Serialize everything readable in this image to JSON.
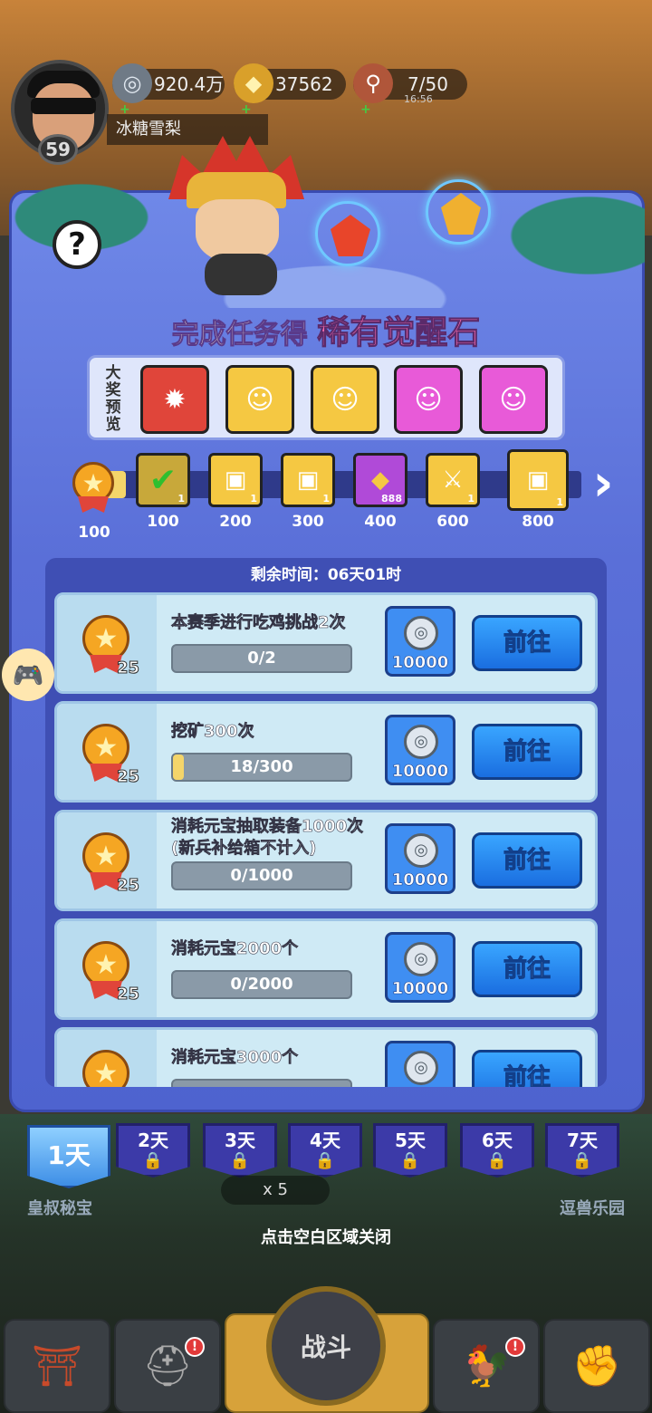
{
  "hud": {
    "player_name": "冰糖雪梨",
    "level": "59",
    "resources": [
      {
        "icon": "silver-coin-icon",
        "value": "920.4万"
      },
      {
        "icon": "gold-ingot-icon",
        "value": "37562"
      },
      {
        "icon": "meat-icon",
        "value": "7/50",
        "timer": "16:56"
      }
    ]
  },
  "event": {
    "title_prefix": "完成任务得",
    "title_highlight": "稀有觉醒石",
    "preview_label": "大奖预览",
    "preview_items": [
      {
        "icon": "red-puzzle-piece-icon",
        "color": "#e0453a"
      },
      {
        "icon": "hero-portrait-icon",
        "color": "#f5c842"
      },
      {
        "icon": "hero-portrait-icon",
        "color": "#f5c842"
      },
      {
        "icon": "heroine-portrait-icon",
        "color": "#e85ad8"
      },
      {
        "icon": "heroine-portrait-icon",
        "color": "#e85ad8"
      }
    ],
    "current_points": "100",
    "progress_fraction": 0.05,
    "milestones": [
      {
        "points": "100",
        "qty": "1",
        "icon": "checkmark-icon",
        "color": "#c8a83a",
        "claimed": true
      },
      {
        "points": "200",
        "qty": "1",
        "icon": "treasure-box-icon",
        "color": "#f5c842"
      },
      {
        "points": "300",
        "qty": "1",
        "icon": "treasure-box-icon",
        "color": "#f5c842"
      },
      {
        "points": "400",
        "qty": "888",
        "icon": "gold-ingot-icon",
        "color": "#b04ad8"
      },
      {
        "points": "600",
        "qty": "1",
        "icon": "sword-scroll-icon",
        "color": "#f5c842"
      },
      {
        "points": "800",
        "qty": "1",
        "icon": "treasure-box-icon",
        "color": "#f5c842"
      }
    ]
  },
  "tasks": {
    "remaining_time": "剩余时间：06天01时",
    "go_label": "前往",
    "items": [
      {
        "title": "本赛季进行吃鸡挑战2次",
        "progress": "0/2",
        "fraction": 0,
        "points": "25",
        "reward": "10000"
      },
      {
        "title": "挖矿300次",
        "progress": "18/300",
        "fraction": 0.06,
        "points": "25",
        "reward": "10000"
      },
      {
        "title": "消耗元宝抽取装备1000次\n(新兵补给箱不计入)",
        "progress": "0/1000",
        "fraction": 0,
        "points": "25",
        "reward": "10000"
      },
      {
        "title": "消耗元宝2000个",
        "progress": "0/2000",
        "fraction": 0,
        "points": "25",
        "reward": "10000"
      },
      {
        "title": "消耗元宝3000个",
        "progress": "",
        "fraction": 0,
        "points": "",
        "reward": ""
      }
    ]
  },
  "days": [
    "1天",
    "2天",
    "3天",
    "4天",
    "5天",
    "6天",
    "7天"
  ],
  "under_labels": {
    "left": "皇叔秘宝",
    "right": "逗兽乐园",
    "ticket": "x 5"
  },
  "close_hint": "点击空白区域关闭",
  "bottom_nav": {
    "fight_label": "战斗"
  }
}
